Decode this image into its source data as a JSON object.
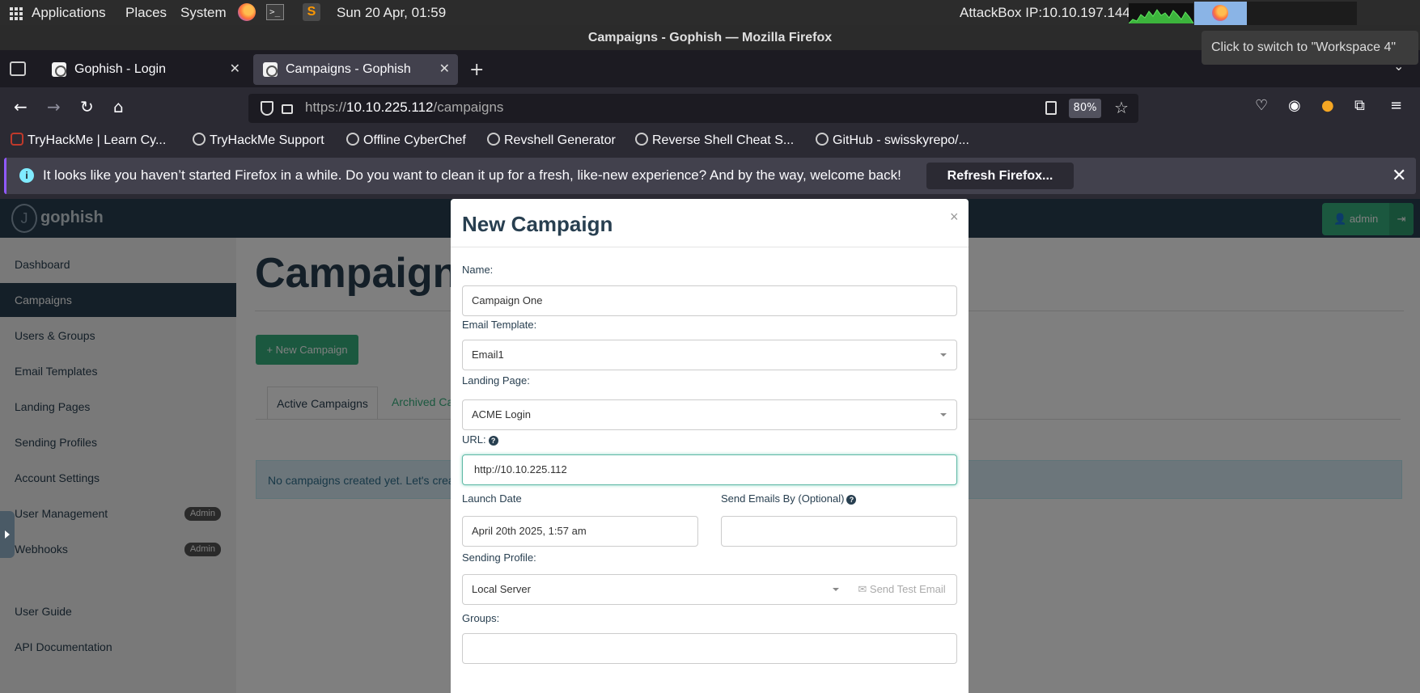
{
  "system_panel": {
    "applications": "Applications",
    "places": "Places",
    "system": "System",
    "clock": "Sun 20 Apr, 01:59",
    "ip_label": "AttackBox IP:10.10.197.144",
    "tooltip": "Click to switch to \"Workspace 4\""
  },
  "window": {
    "title": "Campaigns - Gophish — Mozilla Firefox"
  },
  "tabs": [
    {
      "label": "Gophish - Login",
      "active": false
    },
    {
      "label": "Campaigns - Gophish",
      "active": true
    }
  ],
  "navbar": {
    "url_prefix": "https://",
    "url_host": "10.10.225.112",
    "url_path": "/campaigns",
    "zoom": "80%"
  },
  "bookmarks": [
    {
      "label": "TryHackMe | Learn Cy...",
      "icon": "tryhackme-icon"
    },
    {
      "label": "TryHackMe Support",
      "icon": "support-icon"
    },
    {
      "label": "Offline CyberChef",
      "icon": "chef-icon"
    },
    {
      "label": "Revshell Generator",
      "icon": "globe-icon"
    },
    {
      "label": "Reverse Shell Cheat S...",
      "icon": "globe-icon"
    },
    {
      "label": "GitHub - swisskyrepo/...",
      "icon": "github-icon"
    }
  ],
  "notification": {
    "message": "It looks like you haven’t started Firefox in a while. Do you want to clean it up for a fresh, like-new experience? And by the way, welcome back!",
    "button": "Refresh Firefox..."
  },
  "gophish": {
    "brand": "gophish",
    "admin": "admin",
    "sidebar": [
      {
        "label": "Dashboard",
        "badge": ""
      },
      {
        "label": "Campaigns",
        "badge": "",
        "active": true
      },
      {
        "label": "Users & Groups",
        "badge": ""
      },
      {
        "label": "Email Templates",
        "badge": ""
      },
      {
        "label": "Landing Pages",
        "badge": ""
      },
      {
        "label": "Sending Profiles",
        "badge": ""
      },
      {
        "label": "Account Settings",
        "badge": ""
      },
      {
        "label": "User Management",
        "badge": "Admin"
      },
      {
        "label": "Webhooks",
        "badge": "Admin"
      },
      {
        "label": "User Guide",
        "badge": ""
      },
      {
        "label": "API Documentation",
        "badge": ""
      }
    ],
    "page_title": "Campaign",
    "new_campaign_button": "New Campaign",
    "tab_active": "Active Campaigns",
    "tab_archived": "Archived Ca",
    "empty_alert": "No campaigns created yet. Let's creat"
  },
  "modal": {
    "title": "New Campaign",
    "close": "×",
    "name_label": "Name:",
    "name_value": "Campaign One",
    "email_template_label": "Email Template:",
    "email_template_value": "Email1",
    "landing_page_label": "Landing Page:",
    "landing_page_value": "ACME Login",
    "url_label": "URL:",
    "url_value": "http://10.10.225.112",
    "launch_date_label": "Launch Date",
    "launch_date_value": "April 20th 2025, 1:57 am",
    "send_by_label": "Send Emails By (Optional)",
    "send_by_value": "",
    "sending_profile_label": "Sending Profile:",
    "sending_profile_value": "Local Server",
    "send_test_email": "Send Test Email",
    "groups_label": "Groups:"
  },
  "colors": {
    "gophish_nav": "#283f50",
    "gophish_green": "#37b17e",
    "firefox_bg": "#2b2a33"
  }
}
